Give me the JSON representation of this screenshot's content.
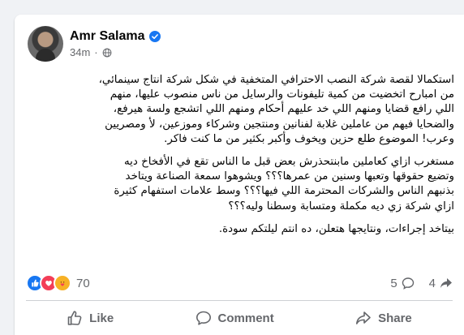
{
  "post": {
    "author": "Amr Salama",
    "time": "34m",
    "dot": "·",
    "paragraphs": [
      "استكمالا لقصة شركة النصب الاحترافي المتخفية في شكل شركة انتاج سينمائي،\nمن امبارح اتخضيت من كمية تليفونات والرسايل من ناس منصوب عليها، منهم\nاللي رافع قضايا ومنهم اللي خد عليهم أحكام ومنهم اللي اتشجع ولسة هيرفع،\nوالضحايا فيهم من عاملين غلابة لفنانين ومنتجين وشركاء وموزعين، لأ ومصريين\nوعرب! الموضوع طلع حزين ويخوف وأكبر بكثير من ما كنت فاكر.",
      "مستغرب ازاي كعاملين مابنتحذرش بعض قبل ما الناس تقع في الأفخاخ ديه\nوتضيع حقوقها وتعبها وسنين من عمرها؟؟؟ ويشوهوا سمعة الصناعة ويتاخد\nبذنبهم الناس والشركات المحترمة اللي فيها؟؟؟ وسط علامات استفهام كثيرة\nازاي شركة زي ديه مكملة ومتسابة وسطنا وليه؟؟؟",
      "بيتاخد إجراءات، ونتايجها هتعلن، ده انتم ليلتكم سودة."
    ]
  },
  "reactions": {
    "count": "70",
    "comments": "5",
    "shares": "4",
    "colors": {
      "like": "#1877f2",
      "love": "#f33e58",
      "care": "#f7b125"
    }
  },
  "actions": {
    "like": "Like",
    "comment": "Comment",
    "share": "Share"
  },
  "icons": {
    "verified": "verified-badge-icon",
    "globe": "globe-icon",
    "like": "thumbs-up-icon",
    "comment": "speech-bubble-icon",
    "share": "share-arrow-icon"
  }
}
